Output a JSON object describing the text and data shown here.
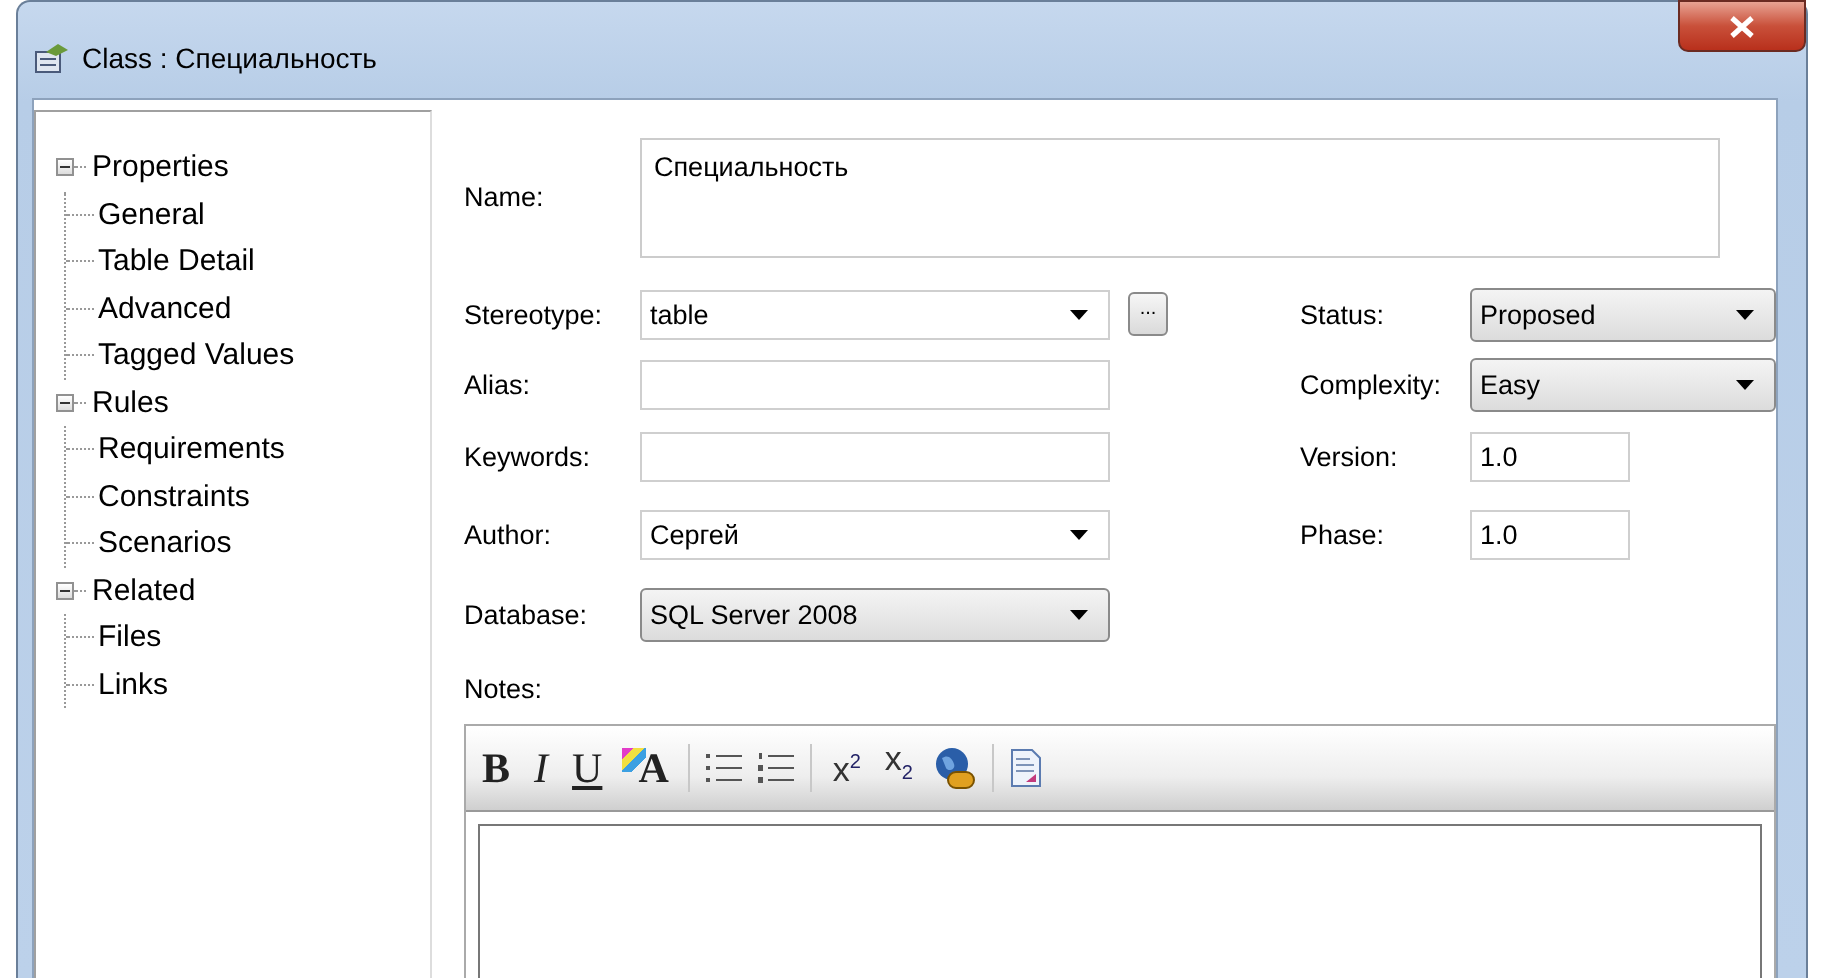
{
  "window": {
    "title": "Class : Специальность"
  },
  "tree": [
    {
      "label": "Properties",
      "expanded": true,
      "children": [
        {
          "label": "General"
        },
        {
          "label": "Table Detail"
        },
        {
          "label": "Advanced"
        },
        {
          "label": "Tagged Values"
        }
      ]
    },
    {
      "label": "Rules",
      "expanded": true,
      "children": [
        {
          "label": "Requirements"
        },
        {
          "label": "Constraints"
        },
        {
          "label": "Scenarios"
        }
      ]
    },
    {
      "label": "Related",
      "expanded": true,
      "children": [
        {
          "label": "Files"
        },
        {
          "label": "Links"
        }
      ]
    }
  ],
  "name": {
    "label": "Name:",
    "value": "Специальность"
  },
  "left_fields": [
    {
      "label": "Stereotype:",
      "kind": "combo",
      "value": "table",
      "browse": "..."
    },
    {
      "label": "Alias:",
      "kind": "text"
    },
    {
      "label": "Keywords:",
      "kind": "text"
    },
    {
      "label": "Author:",
      "kind": "combo",
      "value": "Сергей"
    },
    {
      "label": "Database:",
      "kind": "list",
      "value": "SQL Server 2008"
    }
  ],
  "right_fields": [
    {
      "label": "Status:",
      "kind": "list",
      "value": "Proposed"
    },
    {
      "label": "Complexity:",
      "kind": "list",
      "value": "Easy"
    },
    {
      "label": "Version:",
      "kind": "short",
      "value": "1.0"
    },
    {
      "label": "Phase:",
      "kind": "short",
      "value": "1.0"
    }
  ],
  "notes": {
    "label": "Notes:",
    "toolbar": [
      {
        "kind": "bold",
        "label": "B"
      },
      {
        "kind": "italic",
        "label": "I"
      },
      {
        "kind": "underline",
        "label": "U"
      },
      {
        "kind": "font-color",
        "label": "A"
      },
      {
        "kind": "separator"
      },
      {
        "kind": "bullets"
      },
      {
        "kind": "numbering"
      },
      {
        "kind": "separator"
      },
      {
        "kind": "superscript",
        "label": "x$^{2}$"
      },
      {
        "kind": "subscript",
        "label": "x$_{2}$"
      },
      {
        "kind": "hyperlink"
      },
      {
        "kind": "separator"
      },
      {
        "kind": "document"
      }
    ]
  }
}
